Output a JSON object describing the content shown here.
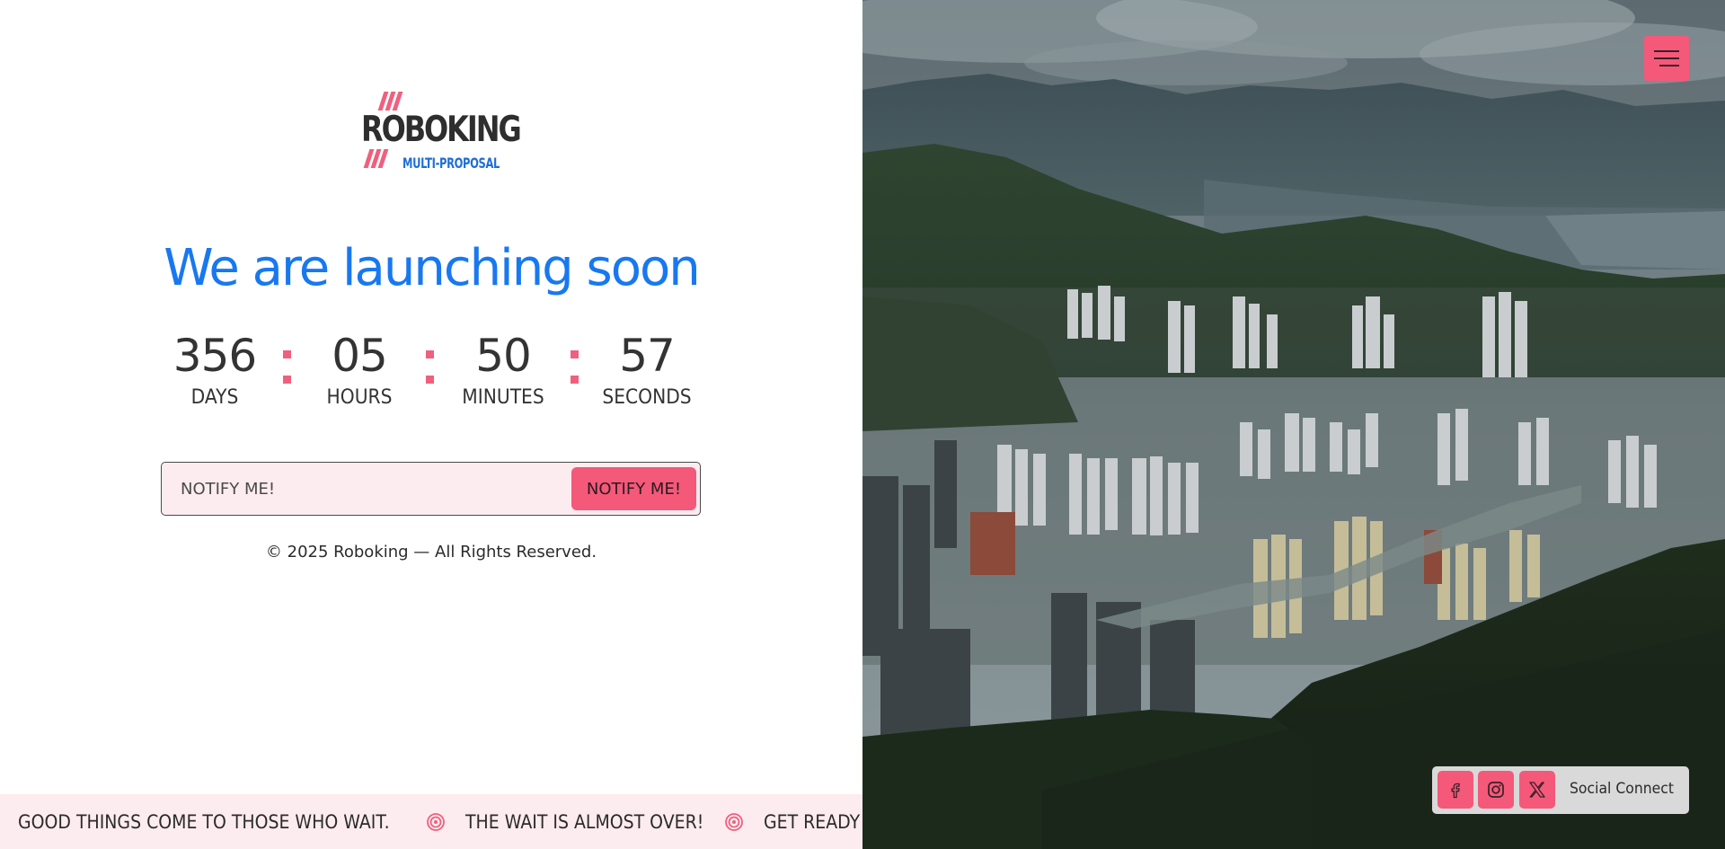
{
  "brand": {
    "name": "ROBOKING",
    "tagline": "MULTI-PROPOSAL"
  },
  "headline": "We are launching soon",
  "countdown": {
    "units": [
      {
        "value": "356",
        "label": "DAYS"
      },
      {
        "value": "05",
        "label": "HOURS"
      },
      {
        "value": "50",
        "label": "MINUTES"
      },
      {
        "value": "57",
        "label": "SECONDS"
      }
    ]
  },
  "notify": {
    "placeholder": "NOTIFY ME!",
    "button_label": "NOTIFY ME!"
  },
  "footer": {
    "copyright": "© 2025 Roboking — All Rights Reserved."
  },
  "ticker": {
    "items": [
      "GOOD THINGS COME TO THOSE WHO WAIT.",
      "THE WAIT IS ALMOST OVER!",
      "GET READY F"
    ],
    "separator_icon": "target-icon"
  },
  "social": {
    "label": "Social Connect",
    "icons": [
      "facebook-icon",
      "instagram-icon",
      "x-icon"
    ]
  },
  "colors": {
    "accent": "#f4597a",
    "headline": "#1878f0",
    "soft_pink": "#fdecef"
  }
}
